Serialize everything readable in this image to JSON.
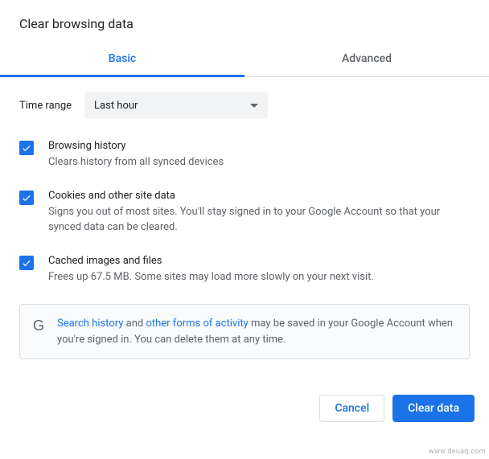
{
  "dialog": {
    "title": "Clear browsing data"
  },
  "tabs": {
    "basic": "Basic",
    "advanced": "Advanced"
  },
  "time_range": {
    "label": "Time range",
    "selected": "Last hour"
  },
  "options": [
    {
      "title": "Browsing history",
      "desc": "Clears history from all synced devices"
    },
    {
      "title": "Cookies and other site data",
      "desc": "Signs you out of most sites. You'll stay signed in to your Google Account so that your synced data can be cleared."
    },
    {
      "title": "Cached images and files",
      "desc": "Frees up 67.5 MB. Some sites may load more slowly on your next visit."
    }
  ],
  "info": {
    "link1": "Search history",
    "mid1": " and ",
    "link2": "other forms of activity",
    "tail": " may be saved in your Google Account when you're signed in. You can delete them at any time."
  },
  "buttons": {
    "cancel": "Cancel",
    "clear": "Clear data"
  },
  "watermark": "www.deuaq.com"
}
